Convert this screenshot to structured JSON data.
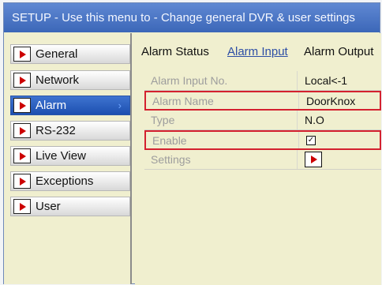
{
  "title": "SETUP - Use this menu to - Change general DVR & user settings",
  "sidebar": {
    "items": [
      {
        "label": "General",
        "icon": "red-arrow-icon",
        "active": false
      },
      {
        "label": "Network",
        "icon": "red-arrow-icon",
        "active": false
      },
      {
        "label": "Alarm",
        "icon": "red-arrow-icon",
        "active": true
      },
      {
        "label": "RS-232",
        "icon": "red-arrow-icon",
        "active": false
      },
      {
        "label": "Live View",
        "icon": "red-arrow-icon",
        "active": false
      },
      {
        "label": "Exceptions",
        "icon": "red-arrow-icon",
        "active": false
      },
      {
        "label": "User",
        "icon": "red-arrow-icon",
        "active": false
      }
    ]
  },
  "tabs": [
    {
      "label": "Alarm Status",
      "active": false
    },
    {
      "label": "Alarm Input",
      "active": true
    },
    {
      "label": "Alarm Output",
      "active": false
    }
  ],
  "alarm_input": {
    "rows": [
      {
        "label": "Alarm Input No.",
        "value": "Local<-1"
      },
      {
        "label": "Alarm Name",
        "value": "DoorKnox"
      },
      {
        "label": "Type",
        "value": "N.O"
      },
      {
        "label": "Enable",
        "value": "✓"
      },
      {
        "label": "Settings",
        "value": ""
      }
    ]
  },
  "colors": {
    "title_bar": "#4d79c8",
    "panel_background": "#f0efcf",
    "active_sidebar": "#275ac0",
    "highlight_red": "#d4212f",
    "arrow_red": "#cc0000"
  }
}
